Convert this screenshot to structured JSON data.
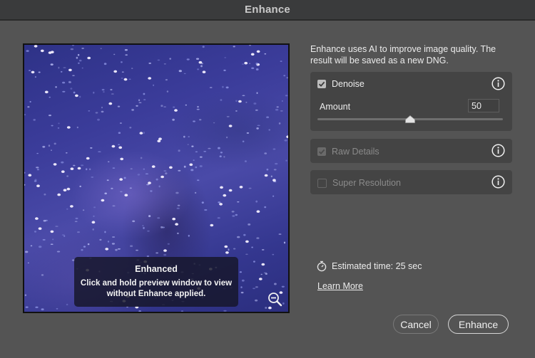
{
  "window": {
    "title": "Enhance"
  },
  "preview": {
    "overlay_title": "Enhanced",
    "overlay_text_line1": "Click and hold preview window to view",
    "overlay_text_line2": "without Enhance applied.",
    "zoom_icon": "zoom-out-icon",
    "colors": {
      "sky_base": "#3b3c9a",
      "star": "#f3efff"
    }
  },
  "description": "Enhance uses AI to improve image quality. The result will be saved as a new DNG.",
  "options": {
    "denoise": {
      "label": "Denoise",
      "checked": true,
      "enabled": true,
      "amount_label": "Amount",
      "amount_value": "50",
      "amount_fraction": 0.5
    },
    "raw_details": {
      "label": "Raw Details",
      "checked": true,
      "enabled": false
    },
    "super_resolution": {
      "label": "Super Resolution",
      "checked": false,
      "enabled": false
    }
  },
  "estimate": {
    "icon": "stopwatch-icon",
    "text": "Estimated time: 25 sec"
  },
  "learn_more": "Learn More",
  "buttons": {
    "cancel": "Cancel",
    "enhance": "Enhance"
  }
}
